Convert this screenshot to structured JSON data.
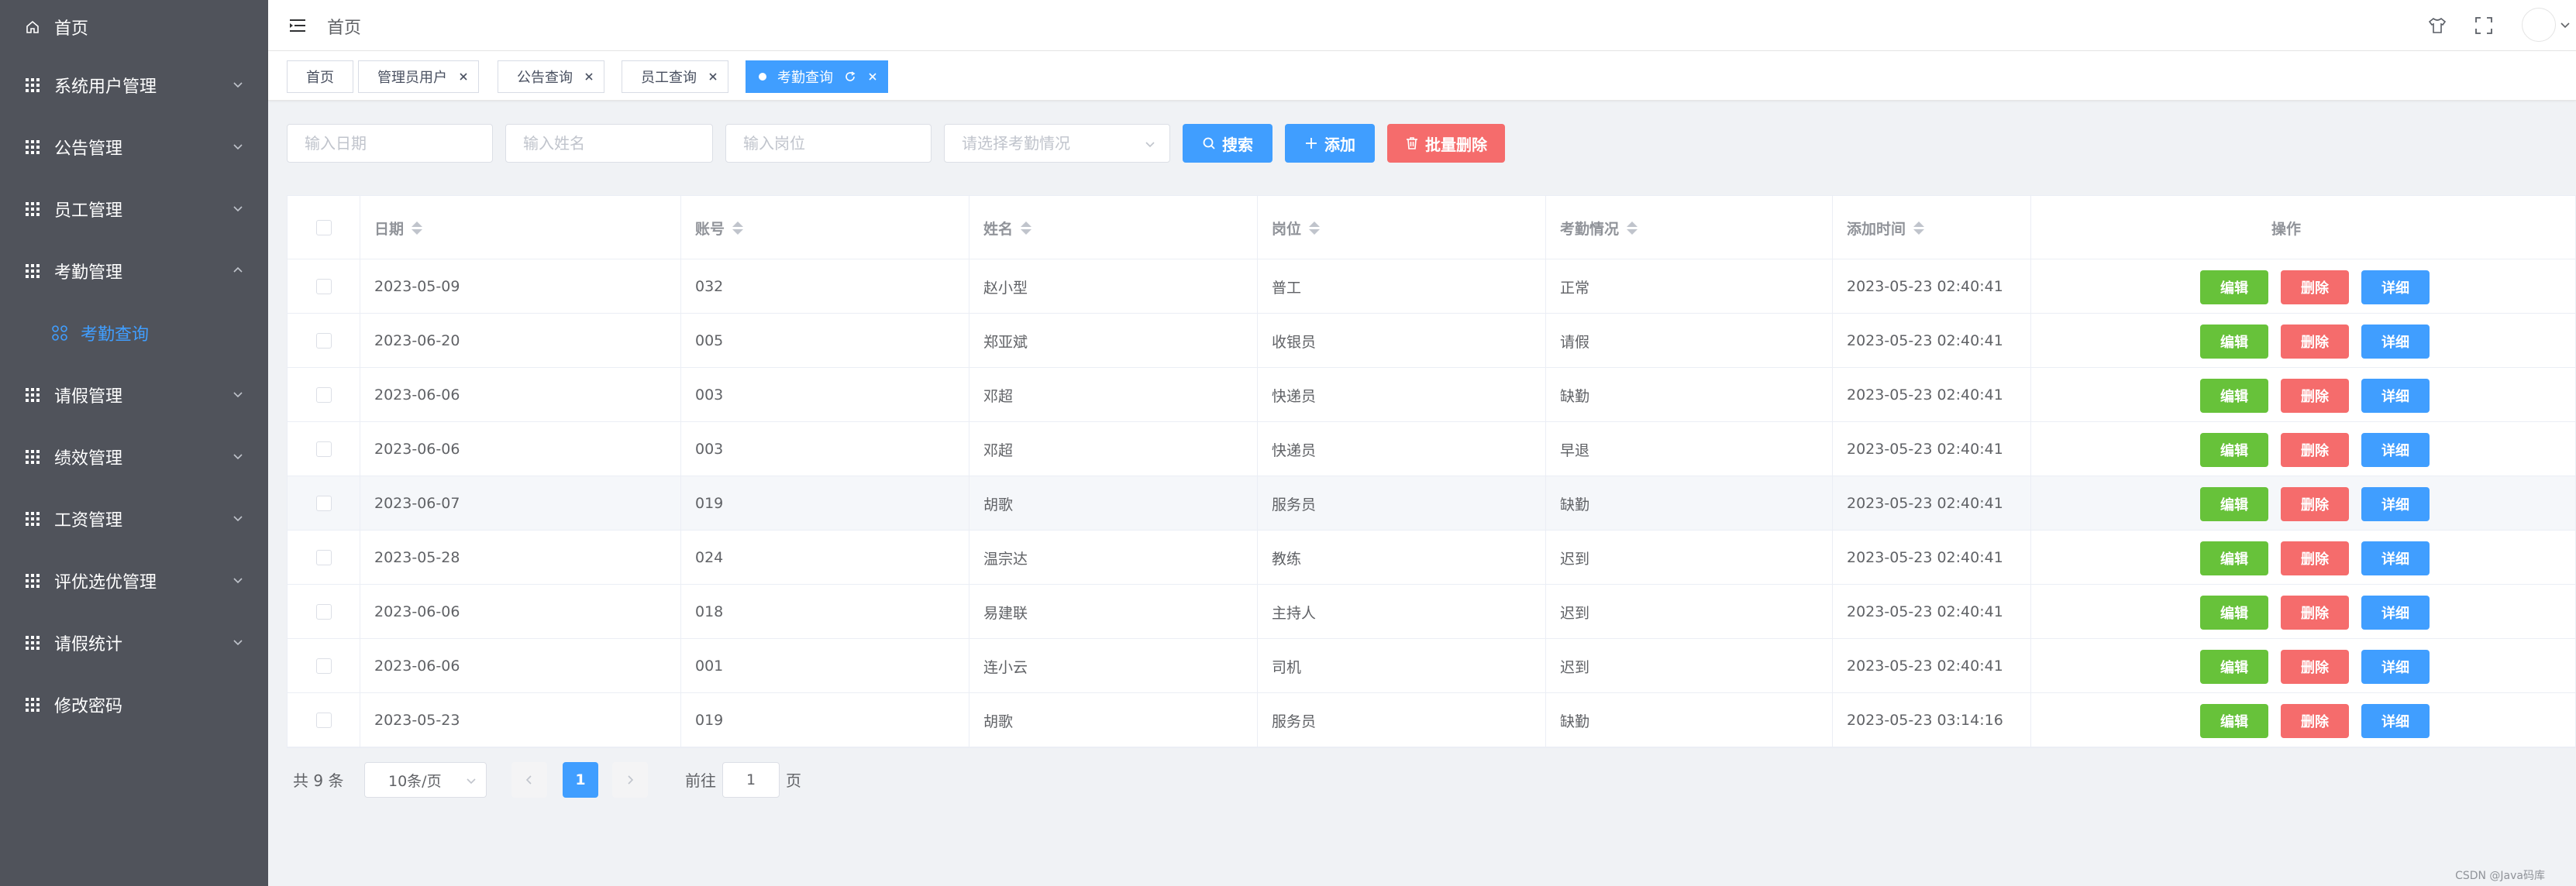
{
  "sidebar": {
    "items": [
      {
        "label": "首页",
        "icon": "home-icon",
        "expandable": false
      },
      {
        "label": "系统用户管理",
        "icon": "grid-icon",
        "expandable": true
      },
      {
        "label": "公告管理",
        "icon": "grid-icon",
        "expandable": true
      },
      {
        "label": "员工管理",
        "icon": "grid-icon",
        "expandable": true
      },
      {
        "label": "考勤管理",
        "icon": "grid-icon",
        "expandable": true,
        "expanded": true
      },
      {
        "label": "考勤查询",
        "icon": "apps-icon",
        "sub": true,
        "active": true
      },
      {
        "label": "请假管理",
        "icon": "grid-icon",
        "expandable": true
      },
      {
        "label": "绩效管理",
        "icon": "grid-icon",
        "expandable": true
      },
      {
        "label": "工资管理",
        "icon": "grid-icon",
        "expandable": true
      },
      {
        "label": "评优选优管理",
        "icon": "grid-icon",
        "expandable": true
      },
      {
        "label": "请假统计",
        "icon": "grid-icon",
        "expandable": true
      },
      {
        "label": "修改密码",
        "icon": "grid-icon",
        "expandable": false
      }
    ]
  },
  "header": {
    "breadcrumb": "首页",
    "icons": [
      "skin-icon",
      "fullscreen-icon",
      "avatar"
    ]
  },
  "tags": [
    {
      "label": "首页",
      "closable": false
    },
    {
      "label": "管理员用户",
      "closable": true
    },
    {
      "label": "公告查询",
      "closable": true
    },
    {
      "label": "员工查询",
      "closable": true
    },
    {
      "label": "考勤查询",
      "closable": true,
      "active": true
    }
  ],
  "search": {
    "date_placeholder": "输入日期",
    "name_placeholder": "输入姓名",
    "post_placeholder": "输入岗位",
    "status_placeholder": "请选择考勤情况",
    "search_label": "搜索",
    "add_label": "添加",
    "batch_delete_label": "批量删除"
  },
  "colors": {
    "primary": "#409eff",
    "success": "#67c23a",
    "danger": "#f56c6c",
    "sidebar_bg": "#50535b"
  },
  "table": {
    "headers": [
      "日期",
      "账号",
      "姓名",
      "岗位",
      "考勤情况",
      "添加时间",
      "操作"
    ],
    "action_labels": {
      "edit": "编辑",
      "delete": "删除",
      "detail": "详细"
    },
    "rows": [
      {
        "date": "2023-05-09",
        "account": "032",
        "name": "赵小型",
        "post": "普工",
        "status": "正常",
        "created": "2023-05-23 02:40:41"
      },
      {
        "date": "2023-06-20",
        "account": "005",
        "name": "郑亚斌",
        "post": "收银员",
        "status": "请假",
        "created": "2023-05-23 02:40:41"
      },
      {
        "date": "2023-06-06",
        "account": "003",
        "name": "邓超",
        "post": "快递员",
        "status": "缺勤",
        "created": "2023-05-23 02:40:41"
      },
      {
        "date": "2023-06-06",
        "account": "003",
        "name": "邓超",
        "post": "快递员",
        "status": "早退",
        "created": "2023-05-23 02:40:41"
      },
      {
        "date": "2023-06-07",
        "account": "019",
        "name": "胡歌",
        "post": "服务员",
        "status": "缺勤",
        "created": "2023-05-23 02:40:41"
      },
      {
        "date": "2023-05-28",
        "account": "024",
        "name": "温宗达",
        "post": "教练",
        "status": "迟到",
        "created": "2023-05-23 02:40:41"
      },
      {
        "date": "2023-06-06",
        "account": "018",
        "name": "易建联",
        "post": "主持人",
        "status": "迟到",
        "created": "2023-05-23 02:40:41"
      },
      {
        "date": "2023-06-06",
        "account": "001",
        "name": "连小云",
        "post": "司机",
        "status": "迟到",
        "created": "2023-05-23 02:40:41"
      },
      {
        "date": "2023-05-23",
        "account": "019",
        "name": "胡歌",
        "post": "服务员",
        "status": "缺勤",
        "created": "2023-05-23 03:14:16"
      }
    ]
  },
  "pagination": {
    "total_text": "共 9 条",
    "page_size": "10条/页",
    "current_page": "1",
    "goto_prefix": "前往",
    "goto_value": "1",
    "goto_suffix": "页"
  },
  "watermark": "CSDN @Java码库"
}
